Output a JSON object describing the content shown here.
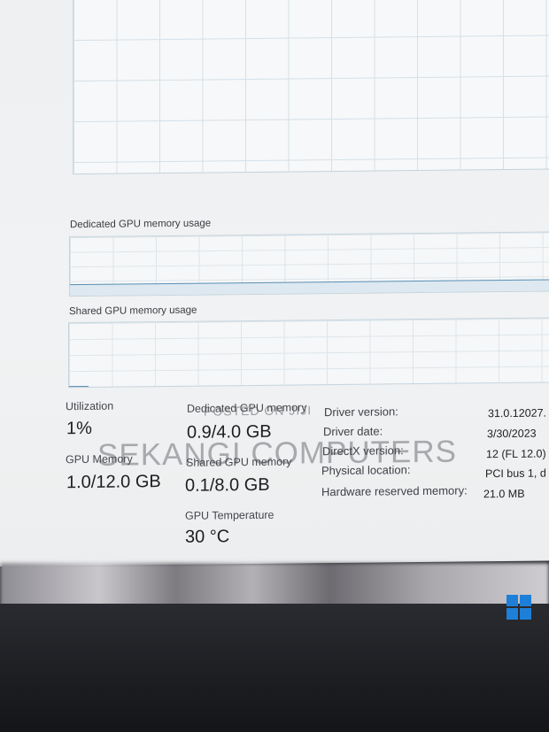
{
  "panels": {
    "dedicated_title": "Dedicated GPU memory usage",
    "shared_title": "Shared GPU memory usage"
  },
  "stats": {
    "utilization": {
      "label": "Utilization",
      "value": "1%"
    },
    "gpu_memory": {
      "label": "GPU Memory",
      "value": "1.0/12.0 GB"
    },
    "dedicated_memory": {
      "label": "Dedicated GPU memory",
      "value": "0.9/4.0 GB"
    },
    "shared_memory": {
      "label": "Shared GPU memory",
      "value": "0.1/8.0 GB"
    },
    "temperature": {
      "label": "GPU Temperature",
      "value": "30 °C"
    }
  },
  "info": [
    {
      "label": "Driver version:",
      "value": "31.0.12027."
    },
    {
      "label": "Driver date:",
      "value": "3/30/2023"
    },
    {
      "label": "DirectX version:",
      "value": "12 (FL 12.0)"
    },
    {
      "label": "Physical location:",
      "value": "PCI bus 1, d"
    },
    {
      "label": "Hardware reserved memory:",
      "value": "21.0 MB"
    }
  ],
  "watermark": {
    "top": "POSTED ON JIJI",
    "main": "SEKANGI COMPUTERS"
  },
  "colors": {
    "graph_line": "#5a8fb4",
    "windows_logo": "#1e7fd8"
  },
  "icons": [
    "windows-logo-icon"
  ]
}
